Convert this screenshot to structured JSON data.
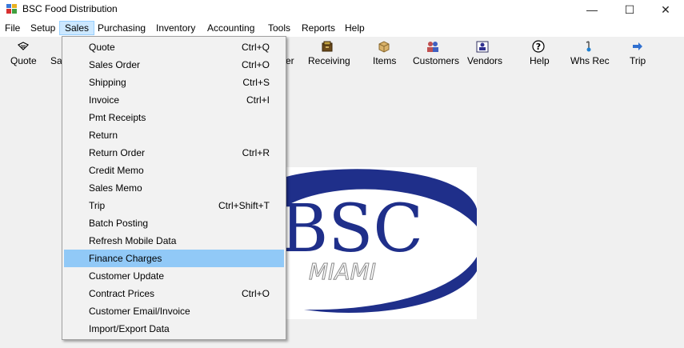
{
  "window": {
    "title": "BSC Food Distribution",
    "controls": {
      "minimize": "—",
      "maximize": "☐",
      "close": "✕"
    }
  },
  "menubar": {
    "items": [
      "File",
      "Setup",
      "Sales",
      "Purchasing",
      "Inventory",
      "Accounting",
      "Tools",
      "Reports",
      "Help"
    ],
    "active": "Sales"
  },
  "toolbar": {
    "quote": "Quote",
    "sales_partial": "Sa",
    "order_partial": "er",
    "receiving": "Receiving",
    "items": "Items",
    "customers": "Customers",
    "vendors": "Vendors",
    "help": "Help",
    "whs_rec": "Whs Rec",
    "trip": "Trip"
  },
  "sales_menu": {
    "items": [
      {
        "label": "Quote",
        "shortcut": "Ctrl+Q"
      },
      {
        "label": "Sales Order",
        "shortcut": "Ctrl+O"
      },
      {
        "label": "Shipping",
        "shortcut": "Ctrl+S"
      },
      {
        "label": "Invoice",
        "shortcut": "Ctrl+I"
      },
      {
        "label": "Pmt Receipts",
        "shortcut": ""
      },
      {
        "label": "Return",
        "shortcut": ""
      },
      {
        "label": "Return Order",
        "shortcut": "Ctrl+R"
      },
      {
        "label": "Credit Memo",
        "shortcut": ""
      },
      {
        "label": "Sales Memo",
        "shortcut": ""
      },
      {
        "label": "Trip",
        "shortcut": "Ctrl+Shift+T"
      },
      {
        "label": "Batch Posting",
        "shortcut": ""
      },
      {
        "label": "Refresh Mobile Data",
        "shortcut": ""
      },
      {
        "label": "Finance Charges",
        "shortcut": ""
      },
      {
        "label": "Customer Update",
        "shortcut": ""
      },
      {
        "label": "Contract Prices",
        "shortcut": "Ctrl+O"
      },
      {
        "label": "Customer Email/Invoice",
        "shortcut": ""
      },
      {
        "label": "Import/Export Data",
        "shortcut": ""
      }
    ],
    "highlighted_index": 12
  },
  "logo": {
    "text": "BSC",
    "subtext": "MIAMI"
  },
  "colors": {
    "menu_highlight": "#91c9f7",
    "active_menu": "#cce8ff",
    "logo_blue": "#1f2f8a"
  }
}
